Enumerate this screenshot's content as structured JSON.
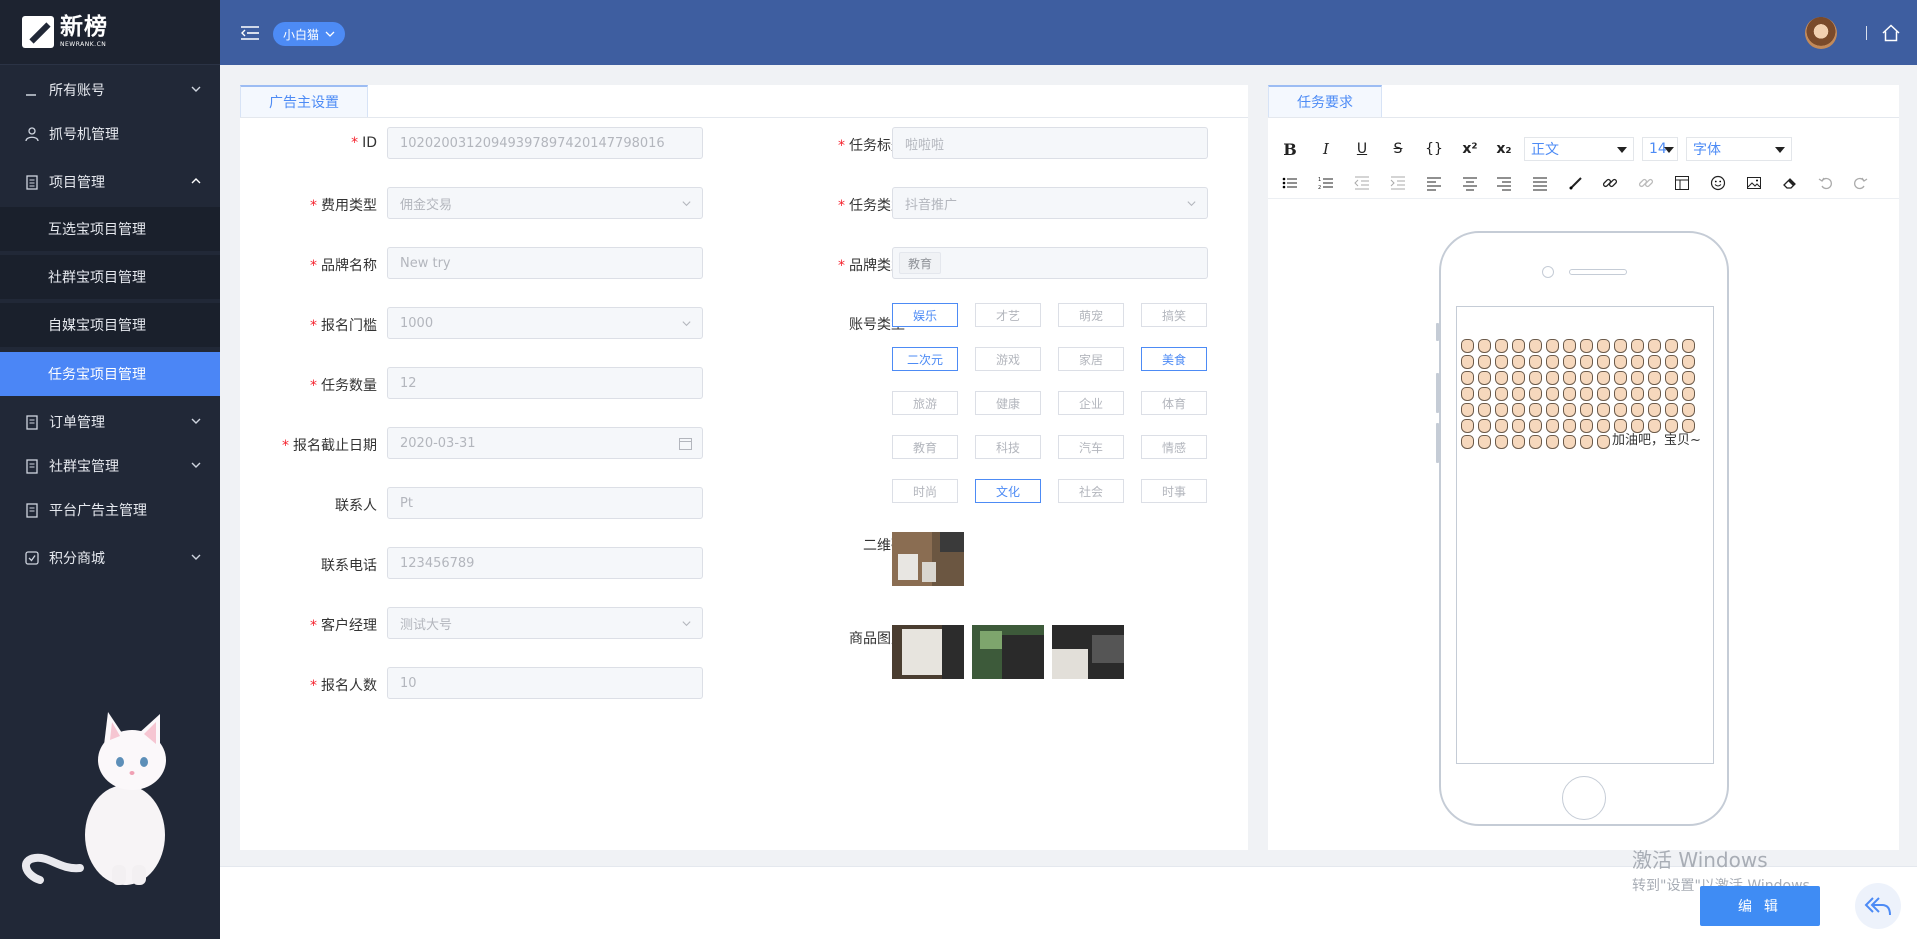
{
  "logo": {
    "cn": "新榜",
    "en": "NEWRANK.CN"
  },
  "sidebar": {
    "items": [
      {
        "label": "所有账号",
        "icon": "dash-icon",
        "expandable": true
      },
      {
        "label": "抓号机管理",
        "icon": "users-icon",
        "expandable": false
      },
      {
        "label": "项目管理",
        "icon": "clipboard-icon",
        "expandable": true,
        "expanded": true
      },
      {
        "label": "订单管理",
        "icon": "clipboard-icon",
        "expandable": true
      },
      {
        "label": "社群宝管理",
        "icon": "clipboard-icon",
        "expandable": true
      },
      {
        "label": "平台广告主管理",
        "icon": "clipboard-icon",
        "expandable": false
      },
      {
        "label": "积分商城",
        "icon": "check-square-icon",
        "expandable": true
      }
    ],
    "sub_items": [
      {
        "label": "互选宝项目管理",
        "active": false
      },
      {
        "label": "社群宝项目管理",
        "active": false
      },
      {
        "label": "自媒宝项目管理",
        "active": false
      },
      {
        "label": "任务宝项目管理",
        "active": true
      }
    ]
  },
  "topbar": {
    "user_label": "小白猫"
  },
  "left_panel": {
    "tab": "广告主设置",
    "fields_left": [
      {
        "label": "ID",
        "required": true,
        "value": "1020200312094939789742014779​8016",
        "type": "text"
      },
      {
        "label": "费用类型",
        "required": true,
        "value": "佣金交易",
        "type": "select"
      },
      {
        "label": "品牌名称",
        "required": true,
        "value": "New try",
        "type": "text"
      },
      {
        "label": "报名门槛",
        "required": true,
        "value": "1000",
        "type": "select"
      },
      {
        "label": "任务数量",
        "required": true,
        "value": "12",
        "type": "text"
      },
      {
        "label": "报名截止日期",
        "required": true,
        "value": "2020-03-31",
        "type": "date"
      },
      {
        "label": "联系人",
        "required": false,
        "value": "Pt",
        "type": "text"
      },
      {
        "label": "联系电话",
        "required": false,
        "value": "123456789",
        "type": "text"
      },
      {
        "label": "客户经理",
        "required": true,
        "value": "测试大号",
        "type": "select"
      },
      {
        "label": "报名人数",
        "required": true,
        "value": "10",
        "type": "text"
      }
    ],
    "fields_right": [
      {
        "label": "任务标题",
        "required": true,
        "value": "啦啦啦",
        "type": "text"
      },
      {
        "label": "任务类型",
        "required": true,
        "value": "抖音推广",
        "type": "select"
      },
      {
        "label": "品牌类型",
        "required": true,
        "value": "教育",
        "type": "tag"
      }
    ],
    "account_type_label": "账号类型",
    "account_types": [
      {
        "label": "娱乐",
        "selected": true
      },
      {
        "label": "才艺",
        "selected": false
      },
      {
        "label": "萌宠",
        "selected": false
      },
      {
        "label": "搞笑",
        "selected": false
      },
      {
        "label": "二次元",
        "selected": true
      },
      {
        "label": "游戏",
        "selected": false
      },
      {
        "label": "家居",
        "selected": false
      },
      {
        "label": "美食",
        "selected": true
      },
      {
        "label": "旅游",
        "selected": false
      },
      {
        "label": "健康",
        "selected": false
      },
      {
        "label": "企业",
        "selected": false
      },
      {
        "label": "体育",
        "selected": false
      },
      {
        "label": "教育",
        "selected": false
      },
      {
        "label": "科技",
        "selected": false
      },
      {
        "label": "汽车",
        "selected": false
      },
      {
        "label": "情感",
        "selected": false
      },
      {
        "label": "时尚",
        "selected": false
      },
      {
        "label": "文化",
        "selected": true
      },
      {
        "label": "社会",
        "selected": false
      },
      {
        "label": "时事",
        "selected": false
      }
    ],
    "qrcode_label": "二维码",
    "product_images_label": "商品图片"
  },
  "right_panel": {
    "tab": "任务要求",
    "toolbar": {
      "bold": "B",
      "italic": "I",
      "underline": "U",
      "strike": "S",
      "code": "{}",
      "superscript": "x²",
      "subscript": "x₂",
      "paragraph_select": "正文",
      "size_select": "14",
      "font_select": "字体"
    },
    "content_text": "加油吧，宝贝~",
    "emoji_count": 93
  },
  "bottom": {
    "edit_label": "编 辑"
  },
  "watermark": {
    "line1": "激活 Windows",
    "line2": "转到\"设置\"以激活 Windows。"
  },
  "colors": {
    "sidebar": "#212837",
    "topbar": "#3e5ea0",
    "accent": "#4d8bf5",
    "active_nav": "#4b86f6"
  }
}
